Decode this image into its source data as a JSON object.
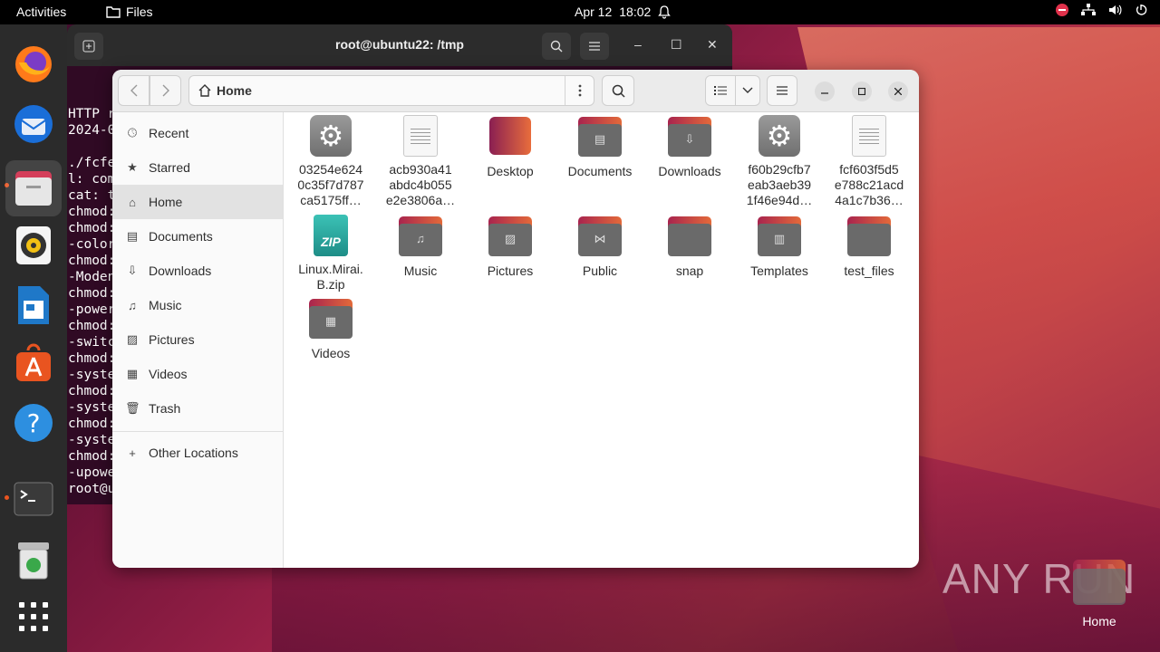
{
  "topbar": {
    "activities": "Activities",
    "app_name": "Files",
    "date": "Apr 12",
    "time": "18:02"
  },
  "terminal": {
    "title": "root@ubuntu22: /tmp",
    "lines": [
      "HTTP r",
      "2024-0",
      "",
      "./fcfe",
      "l: com",
      "cat: t",
      "chmod:",
      "chmod:",
      "-color",
      "chmod:",
      "-Moden",
      "chmod:",
      "-power",
      "chmod:",
      "-switc",
      "chmod:",
      "-syste",
      "chmod:",
      "-syste",
      "chmod:",
      "-syste",
      "chmod:",
      "-upowe",
      "root@u"
    ]
  },
  "files": {
    "path": "Home",
    "sidebar": [
      {
        "label": "Recent",
        "icon": "clock-icon"
      },
      {
        "label": "Starred",
        "icon": "star-icon"
      },
      {
        "label": "Home",
        "icon": "home-icon"
      },
      {
        "label": "Documents",
        "icon": "document-icon"
      },
      {
        "label": "Downloads",
        "icon": "download-icon"
      },
      {
        "label": "Music",
        "icon": "music-icon"
      },
      {
        "label": "Pictures",
        "icon": "picture-icon"
      },
      {
        "label": "Videos",
        "icon": "video-icon"
      },
      {
        "label": "Trash",
        "icon": "trash-icon"
      }
    ],
    "other_locations": "Other Locations",
    "items": [
      {
        "name": "03254e624\n0c35f7d787\nca5175ff…",
        "kind": "exec"
      },
      {
        "name": "acb930a41\nabdc4b055\ne2e3806a…",
        "kind": "text"
      },
      {
        "name": "Desktop",
        "kind": "desktop"
      },
      {
        "name": "Documents",
        "kind": "folder"
      },
      {
        "name": "Downloads",
        "kind": "folder"
      },
      {
        "name": "f60b29cfb7\neab3aeb39\n1f46e94d…",
        "kind": "exec"
      },
      {
        "name": "fcf603f5d5\ne788c21acd\n4a1c7b36…",
        "kind": "text"
      },
      {
        "name": "Linux.Mirai.\nB.zip",
        "kind": "zip"
      },
      {
        "name": "Music",
        "kind": "folder"
      },
      {
        "name": "Pictures",
        "kind": "folder"
      },
      {
        "name": "Public",
        "kind": "folder"
      },
      {
        "name": "snap",
        "kind": "folder"
      },
      {
        "name": "Templates",
        "kind": "folder"
      },
      {
        "name": "test_files",
        "kind": "folder"
      },
      {
        "name": "Videos",
        "kind": "folder"
      }
    ]
  },
  "desktop": {
    "home_label": "Home",
    "watermark": "ANY RUN"
  }
}
